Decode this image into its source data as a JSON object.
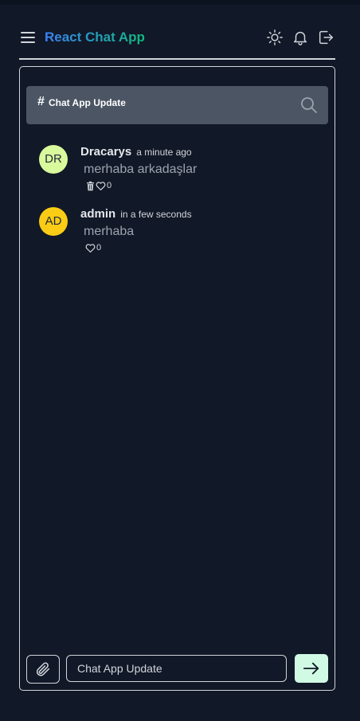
{
  "app": {
    "title": "React Chat App"
  },
  "header": {
    "menu_icon": "hamburger-menu-icon",
    "theme_icon": "sun-icon",
    "notifications_icon": "bell-icon",
    "logout_icon": "logout-icon"
  },
  "channel": {
    "hash": "#",
    "name": "Chat App Update",
    "search_icon": "search-icon"
  },
  "messages": [
    {
      "initials": "DR",
      "user": "Dracarys",
      "time": "a minute ago",
      "text": "merhaba arkadaşlar",
      "likes": "0",
      "avatar_color": "#d9f99d",
      "can_delete": true
    },
    {
      "initials": "AD",
      "user": "admin",
      "time": "in a few seconds",
      "text": "merhaba",
      "likes": "0",
      "avatar_color": "#facc15",
      "can_delete": false
    }
  ],
  "composer": {
    "placeholder": "Chat App Update",
    "attach_icon": "paperclip-icon",
    "send_icon": "arrow-right-icon"
  },
  "colors": {
    "background": "#111827",
    "channel_bar": "#4b5563",
    "send_button": "#d1fae5",
    "title_gradient_start": "#3b82f6",
    "title_gradient_end": "#10b981"
  }
}
